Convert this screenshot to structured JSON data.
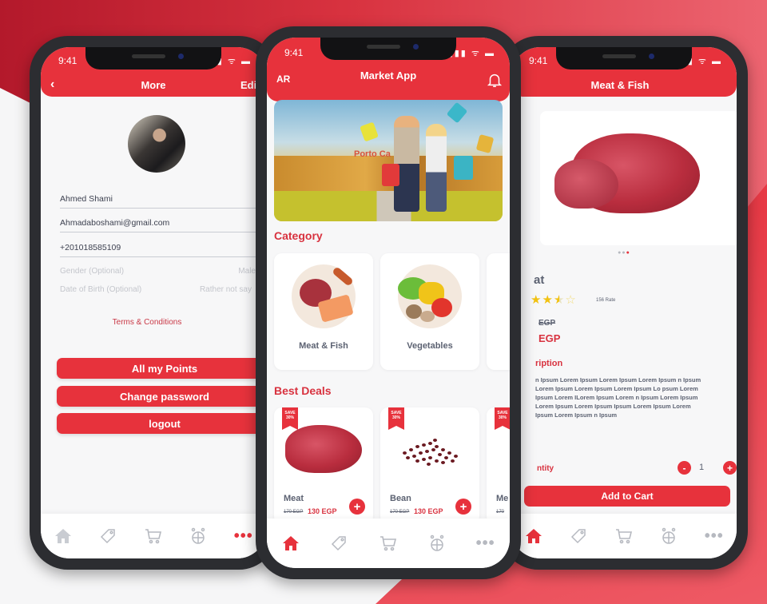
{
  "colors": {
    "accent": "#e7323c",
    "text_dark": "#5c6272",
    "muted": "#b6b9c0",
    "star": "#f2c211"
  },
  "status_bar": {
    "time": "9:41",
    "icons": "signal wifi battery"
  },
  "more_screen": {
    "header": {
      "title": "More",
      "back_icon": "chevron-left-icon",
      "action_label": "Edit"
    },
    "profile": {
      "name": "Ahmed Shami",
      "email": "Ahmadaboshami@gmail.com",
      "phone": "+201018585109",
      "gender_label": "Gender (Optional)",
      "gender_value": "Male",
      "dob_label": "Date of Birth (Optional)",
      "dob_value": "Rather not say"
    },
    "terms_link": "Terms & Conditions",
    "buttons": {
      "points": "All my Points",
      "change_password": "Change password",
      "logout": "logout"
    },
    "active_tab": "more"
  },
  "home_screen": {
    "header": {
      "lang": "AR",
      "title": "Market App",
      "bell_icon": "bell-icon"
    },
    "banner": {
      "sign_text": "Porto Ca"
    },
    "category_title": "Category",
    "categories": [
      {
        "label": "Meat & Fish"
      },
      {
        "label": "Vegetables"
      }
    ],
    "deals_title": "Best Deals",
    "deals": [
      {
        "badge": "SAVE 30%",
        "name": "Meat",
        "old_price": "170 EGP",
        "new_price": "130 EGP"
      },
      {
        "badge": "SAVE 30%",
        "name": "Bean",
        "old_price": "170 EGP",
        "new_price": "130 EGP"
      },
      {
        "badge": "SAVE 30%",
        "name": "Me",
        "old_price": "170",
        "new_price": ""
      }
    ],
    "active_tab": "home"
  },
  "product_screen": {
    "header": {
      "title": "Meat & Fish"
    },
    "pager": {
      "count": 3,
      "active": 3
    },
    "name": "at",
    "rating": {
      "value": 2.5,
      "max": 5,
      "label": "156 Rate"
    },
    "old_price": "EGP",
    "new_price": "EGP",
    "description_title": "ription",
    "description": "n Ipsum Lorem Ipsum Lorem Ipsum Lorem Ipsum n Ipsum Lorem Ipsum Lorem Ipsum Lorem Ipsum Lo psum Lorem Ipsum Lorem ILorem Ipsum Lorem n Ipsum Lorem Ipsum Lorem Ipsum Lorem Ipsum Ipsum Lorem Ipsum Lorem Ipsum Lorem Ipsum n Ipsum",
    "quantity_label": "ntity",
    "quantity": "1",
    "minus_label": "-",
    "plus_label": "+",
    "add_to_cart": "Add to Cart"
  },
  "tabbar": {
    "items": [
      {
        "name": "home",
        "icon": "home-icon"
      },
      {
        "name": "offers",
        "icon": "tag-icon"
      },
      {
        "name": "cart",
        "icon": "cart-icon"
      },
      {
        "name": "global",
        "icon": "globe-icon"
      },
      {
        "name": "more",
        "icon": "more-dots-icon",
        "glyph": "•••"
      }
    ]
  }
}
